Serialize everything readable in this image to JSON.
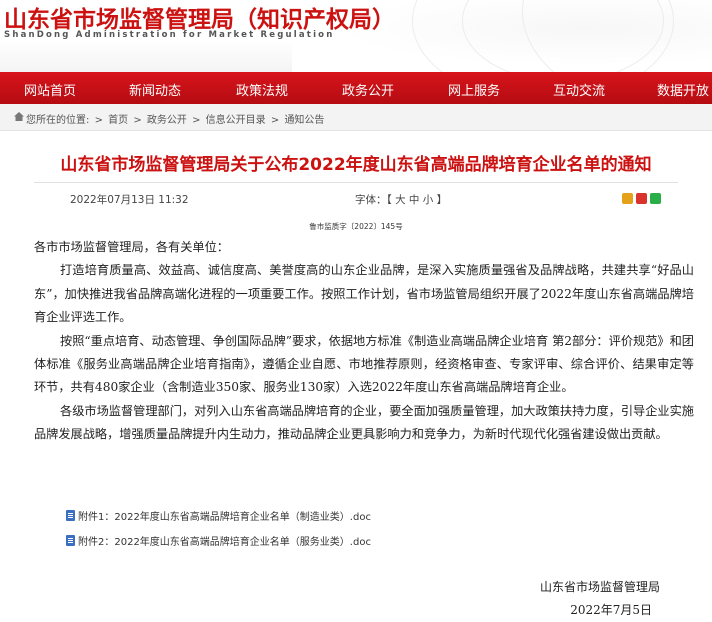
{
  "header": {
    "title": "山东省市场监督管理局（知识产权局）",
    "subtitle": "ShanDong Administration for Market Regulation"
  },
  "nav": {
    "items": [
      "网站首页",
      "新闻动态",
      "政策法规",
      "政务公开",
      "网上服务",
      "互动交流",
      "数据开放"
    ]
  },
  "breadcrumb": {
    "label": "您所在的位置:",
    "items": [
      "首页",
      "政务公开",
      "信息公开目录",
      "通知公告"
    ]
  },
  "article": {
    "title": "山东省市场监督管理局关于公布2022年度山东省高端品牌培育企业名单的通知",
    "date": "2022年07月13日  11:32",
    "font_size_label": "字体：【 大 中 小 】",
    "doc_number": "鲁市监质字〔2022〕145号",
    "salutation": "各市市场监督管理局，各有关单位：",
    "paragraphs": [
      "打造培育质量高、效益高、诚信度高、美誉度高的山东企业品牌，是深入实施质量强省及品牌战略，共建共享“好品山东”，加快推进我省品牌高端化进程的一项重要工作。按照工作计划，省市场监管局组织开展了2022年度山东省高端品牌培育企业评选工作。",
      "按照“重点培育、动态管理、争创国际品牌”要求，依据地方标准《制造业高端品牌企业培育  第2部分：评价规范》和团体标准《服务业高端品牌企业培育指南》，遵循企业自愿、市地推荐原则，经资格审查、专家评审、综合评价、结果审定等环节，共有480家企业（含制造业350家、服务业130家）入选2022年度山东省高端品牌培育企业。",
      "各级市场监督管理部门，对列入山东省高端品牌培育的企业，要全面加强质量管理，加大政策扶持力度，引导企业实施品牌发展战略，增强质量品牌提升内生动力，推动品牌企业更具影响力和竞争力，为新时代现代化强省建设做出贡献。"
    ],
    "attachments": [
      "附件1：2022年度山东省高端品牌培育企业名单（制造业类）.doc",
      "附件2：2022年度山东省高端品牌培育企业名单（服务业类）.doc"
    ],
    "signature_org": "山东省市场监督管理局",
    "signature_date": "2022年7月5日"
  },
  "colors": {
    "brand_red": "#cc1111",
    "nav_red": "#c8101a"
  }
}
